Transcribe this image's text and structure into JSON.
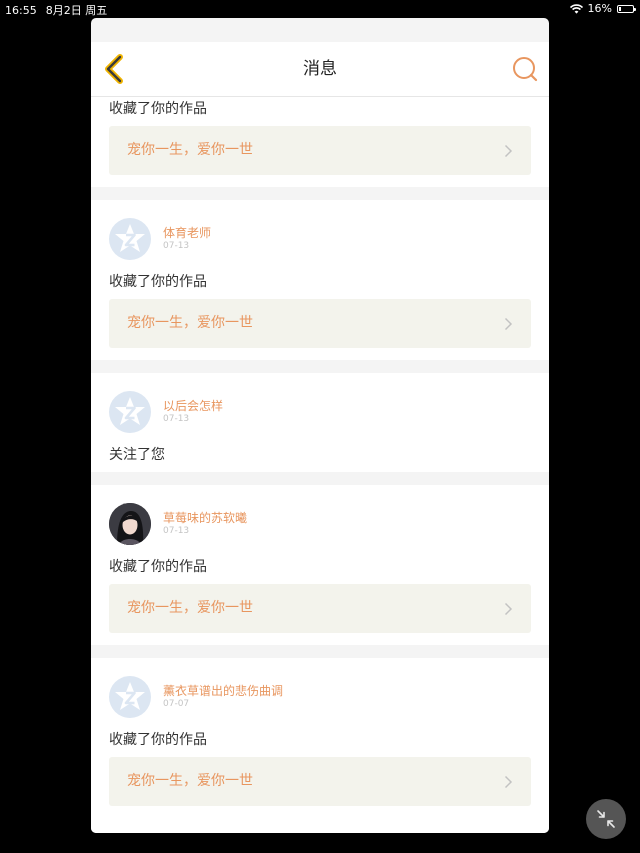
{
  "status_bar": {
    "time": "16:55",
    "date": "8月2日 周五",
    "battery": "16%",
    "battery_level": 0.16
  },
  "nav": {
    "title": "消息"
  },
  "partial_card": {
    "action": "收藏了你的作品",
    "work_title": "宠你一生，爱你一世"
  },
  "messages": [
    {
      "username": "体育老师",
      "date": "07-13",
      "action": "收藏了你的作品",
      "work_title": "宠你一生，爱你一世",
      "avatar": "default-avatar"
    },
    {
      "username": "以后会怎样",
      "date": "07-13",
      "action": "关注了您",
      "avatar": "default-avatar"
    },
    {
      "username": "草莓味的苏软曦",
      "date": "07-13",
      "action": "收藏了你的作品",
      "work_title": "宠你一生，爱你一世",
      "avatar": "photo-avatar"
    },
    {
      "username": "薰衣草谱出的悲伤曲调",
      "date": "07-07",
      "action": "收藏了你的作品",
      "work_title": "宠你一生，爱你一世",
      "avatar": "default-avatar"
    }
  ],
  "colors": {
    "accent": "#e8965f",
    "back_icon": "#f0b400",
    "work_bg": "#f3f3ec"
  }
}
